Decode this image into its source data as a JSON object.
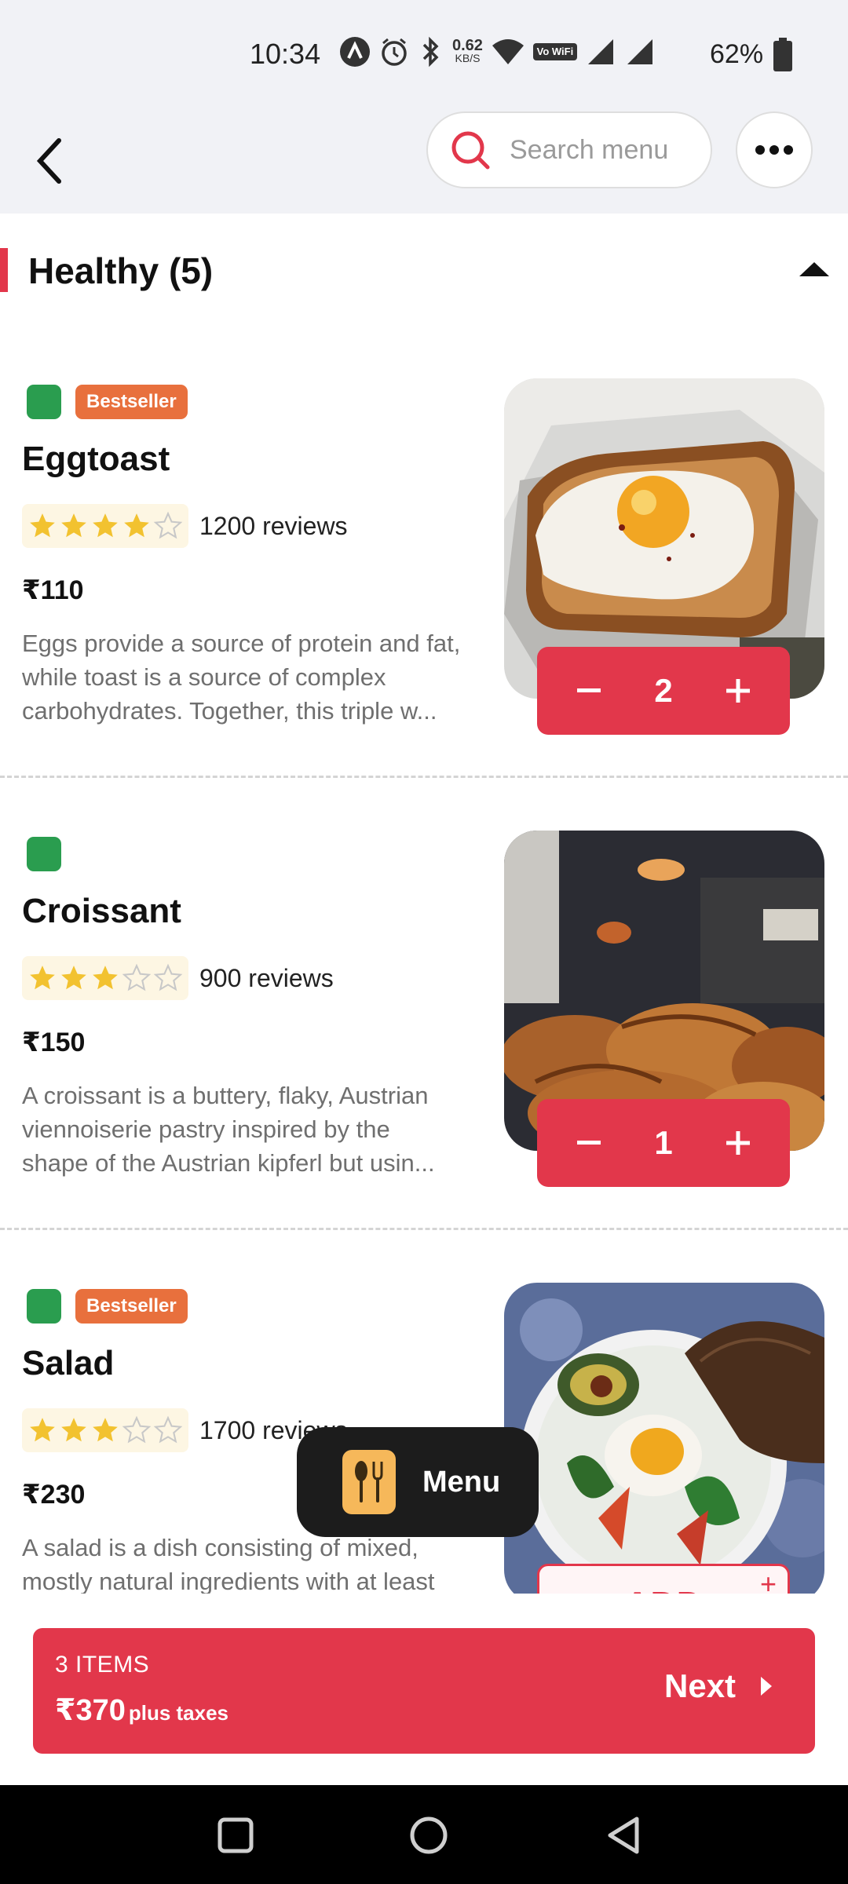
{
  "status_bar": {
    "time": "10:34",
    "net_speed_value": "0.62",
    "net_speed_unit": "KB/S",
    "volte_label": "Vo WiFi",
    "battery_percent": "62%"
  },
  "header": {
    "search_placeholder": "Search menu"
  },
  "section": {
    "title": "Healthy (5)"
  },
  "items": [
    {
      "name": "Eggtoast",
      "badge": "Bestseller",
      "rating": 4,
      "reviews": "1200 reviews",
      "price": "₹110",
      "description": "Eggs provide a source of protein and fat, while toast is a source of complex carbohydrates. Together, this triple w...",
      "quantity": "2"
    },
    {
      "name": "Croissant",
      "badge": "",
      "rating": 3,
      "reviews": "900 reviews",
      "price": "₹150",
      "description": "A croissant is a buttery, flaky, Austrian viennoiserie pastry inspired by the shape of the Austrian kipferl but usin...",
      "quantity": "1"
    },
    {
      "name": "Salad",
      "badge": "Bestseller",
      "rating": 3,
      "reviews": "1700 reviews",
      "price": "₹230",
      "description": "A salad is a dish consisting of mixed, mostly natural ingredients with at least",
      "add_label": "ADD",
      "add_plus": "+"
    }
  ],
  "floating_menu": {
    "label": "Menu"
  },
  "cart": {
    "count_label": "3 ITEMS",
    "total": "₹370",
    "taxes_label": "plus taxes",
    "next_label": "Next"
  },
  "colors": {
    "accent": "#e2374b",
    "veg": "#2a9d4f",
    "badge": "#e8703d",
    "star": "#f2c230"
  }
}
